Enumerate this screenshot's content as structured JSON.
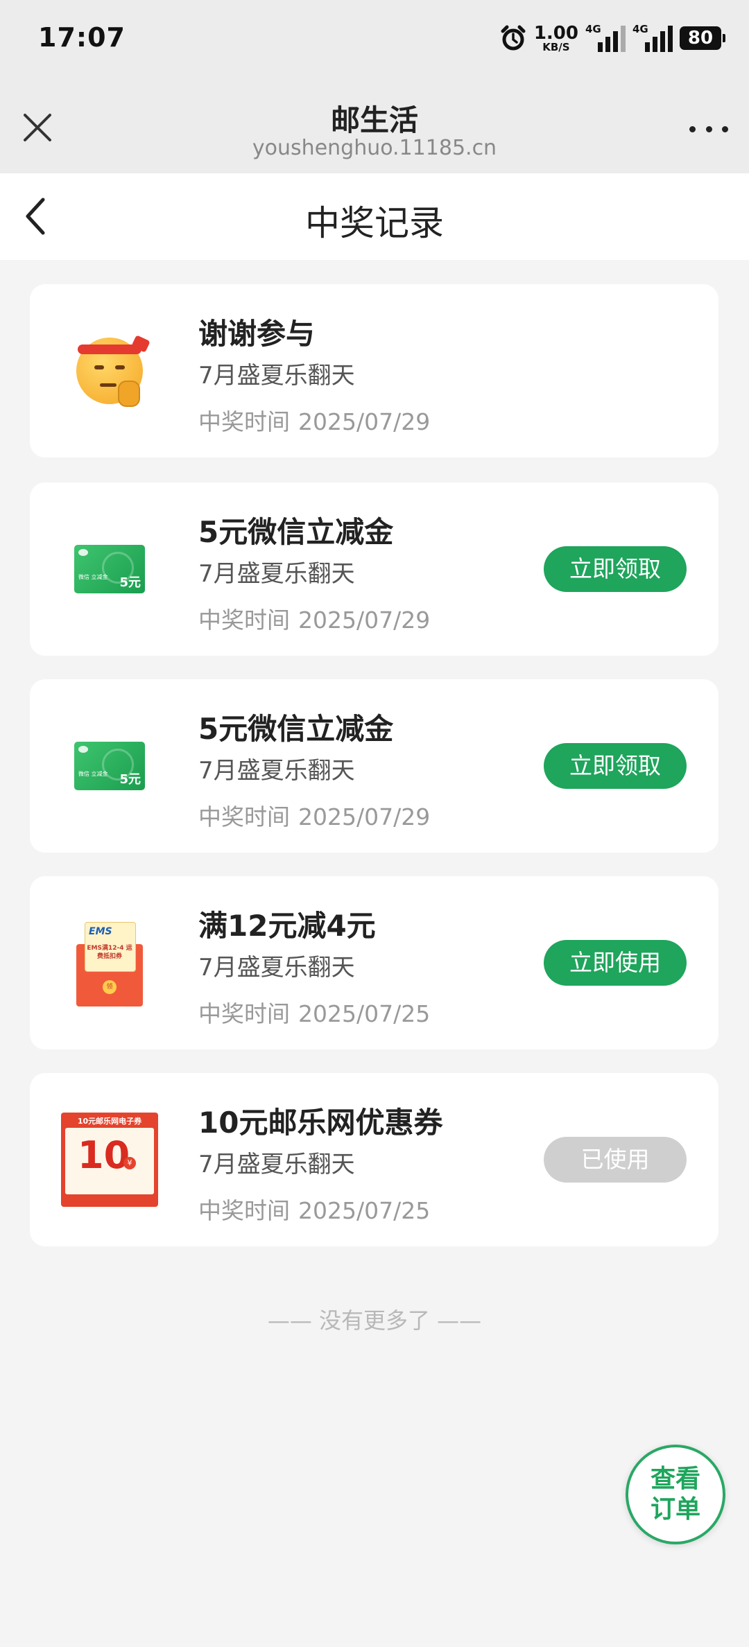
{
  "status_bar": {
    "time": "17:07",
    "speed_value": "1.00",
    "speed_unit": "KB/S",
    "signal1_tag": "4G",
    "signal2_tag": "4G",
    "battery": "80",
    "icons": [
      "alarm-icon",
      "signal-icon",
      "signal-icon",
      "battery-icon"
    ]
  },
  "web_header": {
    "title": "邮生活",
    "url": "youshenghuo.11185.cn"
  },
  "page": {
    "title": "中奖记录"
  },
  "records": [
    {
      "title": "谢谢参与",
      "activity": "7月盛夏乐翻天",
      "time_label": "中奖时间",
      "time": "2025/07/29",
      "button": null,
      "thumb": "thinking-emoji-icon"
    },
    {
      "title": "5元微信立减金",
      "activity": "7月盛夏乐翻天",
      "time_label": "中奖时间",
      "time": "2025/07/29",
      "button": "立即领取",
      "thumb": "wechat-pay-card-icon",
      "thumb_amount": "5元",
      "thumb_text": "微信 立减金"
    },
    {
      "title": "5元微信立减金",
      "activity": "7月盛夏乐翻天",
      "time_label": "中奖时间",
      "time": "2025/07/29",
      "button": "立即领取",
      "thumb": "wechat-pay-card-icon",
      "thumb_amount": "5元",
      "thumb_text": "微信 立减金"
    },
    {
      "title": "满12元减4元",
      "activity": "7月盛夏乐翻天",
      "time_label": "中奖时间",
      "time": "2025/07/25",
      "button": "立即使用",
      "thumb": "ems-coupon-envelope-icon",
      "thumb_brand": "EMS",
      "thumb_text": "EMS满12-4 运费抵扣券",
      "thumb_seal": "领"
    },
    {
      "title": "10元邮乐网优惠券",
      "activity": "7月盛夏乐翻天",
      "time_label": "中奖时间",
      "time": "2025/07/25",
      "button": "已使用",
      "button_state": "disabled",
      "thumb": "youle-coupon-icon",
      "thumb_header": "10元邮乐网电子券",
      "thumb_amount": "10",
      "thumb_currency": "¥"
    }
  ],
  "footer_text": "—— 没有更多了 ——",
  "fab_label": "查看订单",
  "colors": {
    "accent": "#1fa55c",
    "disabled": "#cfcfcf",
    "background": "#f4f4f4"
  }
}
